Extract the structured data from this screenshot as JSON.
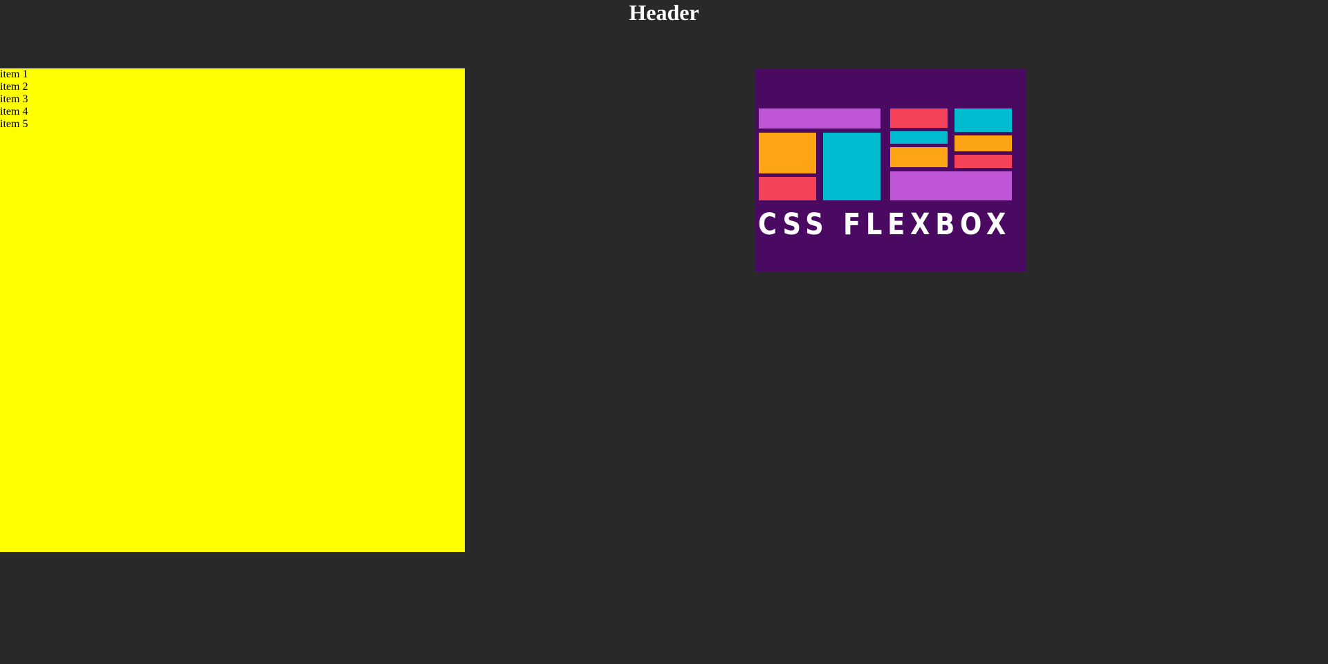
{
  "header": {
    "title": "Header"
  },
  "list": {
    "items": [
      "item 1",
      "item 2",
      "item 3",
      "item 4",
      "item 5"
    ]
  },
  "logo": {
    "text": "CSS FLEXBOX",
    "colors": {
      "background": "#4a0a62",
      "purple": "#bd55d4",
      "pink": "#f54258",
      "orange": "#ffa515",
      "cyan": "#00bcd0",
      "text": "#ffffff"
    }
  },
  "colors": {
    "page_background": "#292929",
    "list_background": "#ffff00"
  }
}
